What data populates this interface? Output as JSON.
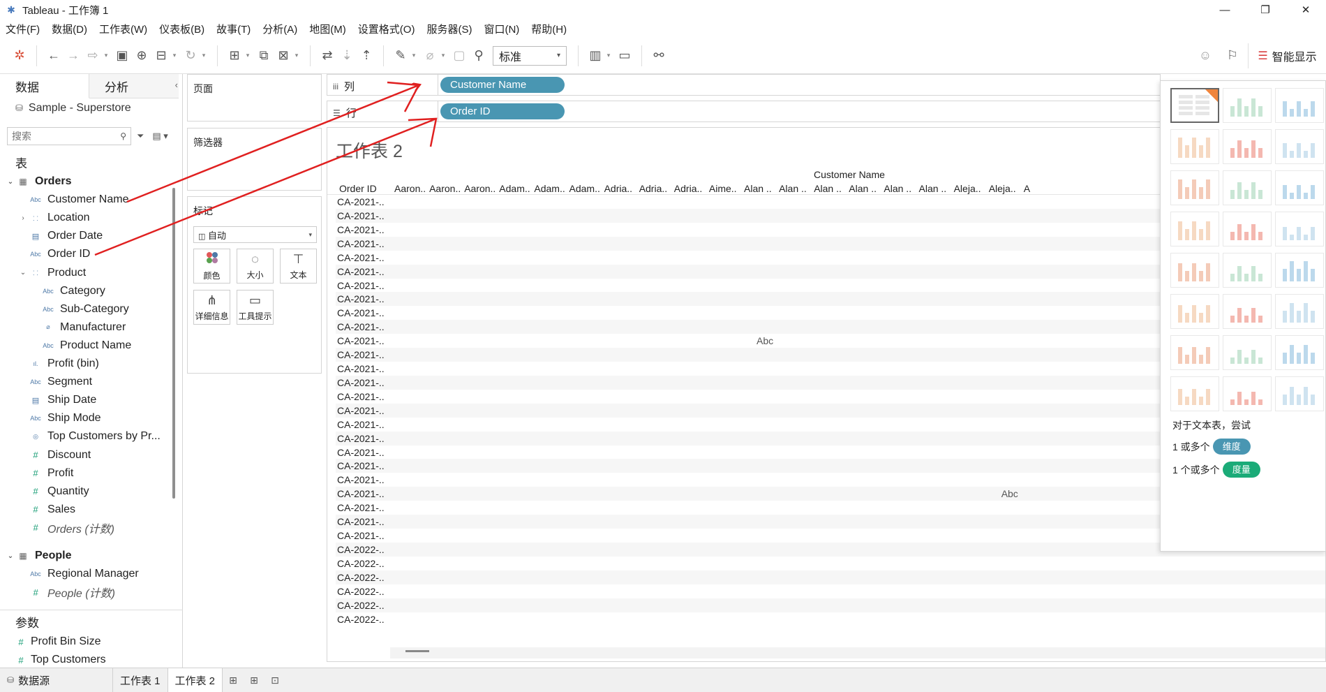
{
  "window": {
    "title": "Tableau - 工作簿 1",
    "minimize": "—",
    "maximize": "❐",
    "close": "✕"
  },
  "menu": [
    "文件(F)",
    "数据(D)",
    "工作表(W)",
    "仪表板(B)",
    "故事(T)",
    "分析(A)",
    "地图(M)",
    "设置格式(O)",
    "服务器(S)",
    "窗口(N)",
    "帮助(H)"
  ],
  "toolbar": {
    "fit_select": "标准",
    "show_me_label": "智能显示"
  },
  "data_pane": {
    "tab_data": "数据",
    "tab_analysis": "分析",
    "datasource": "Sample - Superstore",
    "search_placeholder": "搜索",
    "tables_heading": "表",
    "params_heading": "参数",
    "fields": [
      {
        "label": "Orders",
        "kind": "table",
        "icon": "",
        "indent": 1,
        "caret": "⌄",
        "bold": true
      },
      {
        "label": "Customer Name",
        "kind": "dim",
        "icon": "Abc",
        "indent": 2,
        "caret": ""
      },
      {
        "label": "Location",
        "kind": "hier",
        "icon": "⸬",
        "indent": 2,
        "caret": "›"
      },
      {
        "label": "Order Date",
        "kind": "date",
        "icon": "▤",
        "indent": 2,
        "caret": ""
      },
      {
        "label": "Order ID",
        "kind": "dim",
        "icon": "Abc",
        "indent": 2,
        "caret": ""
      },
      {
        "label": "Product",
        "kind": "hier",
        "icon": "⸬",
        "indent": 2,
        "caret": "⌄"
      },
      {
        "label": "Category",
        "kind": "dim",
        "icon": "Abc",
        "indent": 3,
        "caret": ""
      },
      {
        "label": "Sub-Category",
        "kind": "dim",
        "icon": "Abc",
        "indent": 3,
        "caret": ""
      },
      {
        "label": "Manufacturer",
        "kind": "group",
        "icon": "⌀",
        "indent": 3,
        "caret": ""
      },
      {
        "label": "Product Name",
        "kind": "dim",
        "icon": "Abc",
        "indent": 3,
        "caret": ""
      },
      {
        "label": "Profit (bin)",
        "kind": "bin",
        "icon": "ıl.",
        "indent": 2,
        "caret": ""
      },
      {
        "label": "Segment",
        "kind": "dim",
        "icon": "Abc",
        "indent": 2,
        "caret": ""
      },
      {
        "label": "Ship Date",
        "kind": "date",
        "icon": "▤",
        "indent": 2,
        "caret": ""
      },
      {
        "label": "Ship Mode",
        "kind": "dim",
        "icon": "Abc",
        "indent": 2,
        "caret": ""
      },
      {
        "label": "Top Customers by Pr...",
        "kind": "set",
        "icon": "◎",
        "indent": 2,
        "caret": ""
      },
      {
        "label": "Discount",
        "kind": "meas",
        "icon": "#",
        "indent": 2,
        "caret": ""
      },
      {
        "label": "Profit",
        "kind": "meas",
        "icon": "#",
        "indent": 2,
        "caret": ""
      },
      {
        "label": "Quantity",
        "kind": "meas",
        "icon": "#",
        "indent": 2,
        "caret": ""
      },
      {
        "label": "Sales",
        "kind": "meas",
        "icon": "#",
        "indent": 2,
        "caret": ""
      },
      {
        "label": "Orders (计数)",
        "kind": "meas",
        "icon": "#",
        "indent": 2,
        "caret": "",
        "italic": true
      },
      {
        "label": "People",
        "kind": "table",
        "icon": "",
        "indent": 1,
        "caret": "⌄",
        "bold": true
      },
      {
        "label": "Regional Manager",
        "kind": "dim",
        "icon": "Abc",
        "indent": 2,
        "caret": ""
      },
      {
        "label": "People (计数)",
        "kind": "meas",
        "icon": "#",
        "indent": 2,
        "caret": "",
        "italic": true
      }
    ],
    "params": [
      {
        "label": "Profit Bin Size",
        "icon": "#"
      },
      {
        "label": "Top Customers",
        "icon": "#"
      }
    ]
  },
  "cards": {
    "pages": "页面",
    "filters": "筛选器",
    "marks": "标记",
    "marks_type": "自动",
    "mark_buttons": [
      "颜色",
      "大小",
      "文本",
      "详细信息",
      "工具提示"
    ]
  },
  "shelves": {
    "columns_label": "列",
    "rows_label": "行",
    "columns_pill": "Customer Name",
    "rows_pill": "Order ID"
  },
  "view": {
    "sheet_title": "工作表 2",
    "col_header_title": "Customer Name",
    "row_header_title": "Order ID",
    "column_headers": [
      "Aaron..",
      "Aaron..",
      "Aaron..",
      "Adam..",
      "Adam..",
      "Adam..",
      "Adria..",
      "Adria..",
      "Adria..",
      "Aime..",
      "Alan ..",
      "Alan ..",
      "Alan ..",
      "Alan ..",
      "Alan ..",
      "Alan ..",
      "Aleja..",
      "Aleja..",
      "A"
    ],
    "rows": [
      "CA-2021-..",
      "CA-2021-..",
      "CA-2021-..",
      "CA-2021-..",
      "CA-2021-..",
      "CA-2021-..",
      "CA-2021-..",
      "CA-2021-..",
      "CA-2021-..",
      "CA-2021-..",
      "CA-2021-..",
      "CA-2021-..",
      "CA-2021-..",
      "CA-2021-..",
      "CA-2021-..",
      "CA-2021-..",
      "CA-2021-..",
      "CA-2021-..",
      "CA-2021-..",
      "CA-2021-..",
      "CA-2021-..",
      "CA-2021-..",
      "CA-2021-..",
      "CA-2021-..",
      "CA-2021-..",
      "CA-2022-..",
      "CA-2022-..",
      "CA-2022-..",
      "CA-2022-..",
      "CA-2022-..",
      "CA-2022-.."
    ],
    "cell_marks": [
      {
        "text": "Abc",
        "row": 10,
        "col": 10
      },
      {
        "text": "Abc",
        "row": 21,
        "col": 17
      }
    ]
  },
  "show_me": {
    "hint": "对于文本表，尝试",
    "req_dim_prefix": "1 或多个",
    "req_dim_pill": "维度",
    "req_meas_prefix": "1 个或多个",
    "req_meas_pill": "度量",
    "colors": {
      "dim": "#4996b2",
      "meas": "#1bab78",
      "accent": "#f0853c"
    }
  },
  "tabbar": {
    "datasource_tab": "数据源",
    "sheets": [
      "工作表 1",
      "工作表 2"
    ],
    "active_sheet": 1
  },
  "colors": {
    "pill": "#4996b2",
    "arrow": "#e02020"
  }
}
